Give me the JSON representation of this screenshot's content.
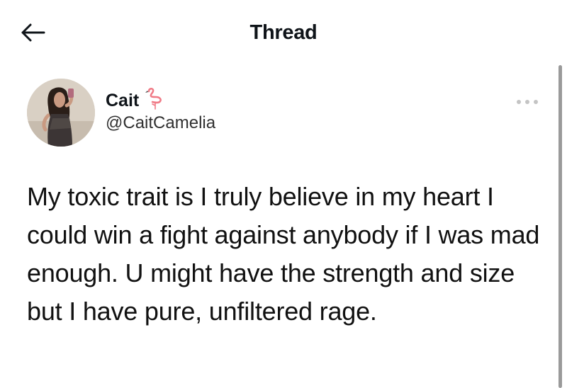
{
  "header": {
    "title": "Thread",
    "back_icon": "arrow-left-icon"
  },
  "author": {
    "display_name": "Cait",
    "emoji_icon": "flamingo-icon",
    "handle": "@CaitCamelia"
  },
  "tweet": {
    "text": "My toxic trait is I truly believe in my heart I could win a fight against anybody if I was mad enough. U might have the strength and size but I have pure, unfiltered rage."
  },
  "more_icon": "more-horizontal-icon",
  "colors": {
    "text": "#0f1419",
    "secondary": "#303030",
    "flamingo": "#f07a86",
    "more_icon": "#c4c4c4"
  }
}
